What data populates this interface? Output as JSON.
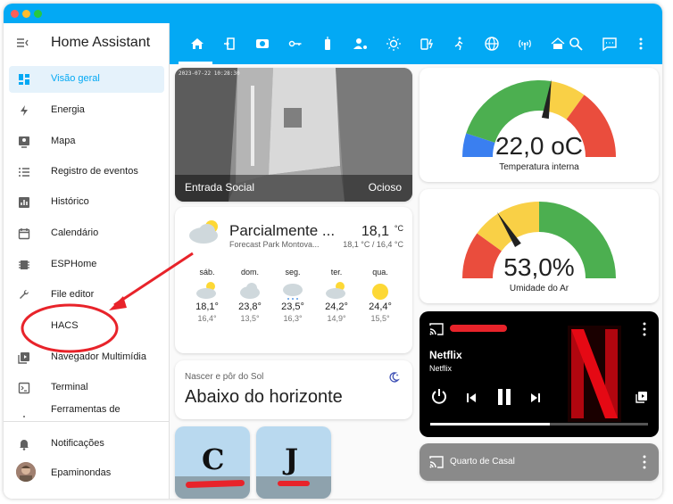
{
  "app": {
    "title": "Home Assistant"
  },
  "colors": {
    "primary": "#03a9f4",
    "active_bg": "#e5f2fb",
    "gauge_green": "#4caf50",
    "gauge_yellow": "#f9d046",
    "gauge_red": "#ea4d3d",
    "gauge_blue": "#3a7ff0",
    "annotation_red": "#e8232a"
  },
  "sidebar": {
    "menu_icon": "menu-open-icon",
    "items": [
      {
        "label": "Visão geral",
        "icon": "view-dashboard-icon",
        "active": true
      },
      {
        "label": "Energia",
        "icon": "lightning-bolt-icon"
      },
      {
        "label": "Mapa",
        "icon": "map-icon"
      },
      {
        "label": "Registro de eventos",
        "icon": "list-icon"
      },
      {
        "label": "Histórico",
        "icon": "chart-box-icon"
      },
      {
        "label": "Calendário",
        "icon": "calendar-icon"
      },
      {
        "label": "ESPHome",
        "icon": "chip-icon"
      },
      {
        "label": "File editor",
        "icon": "wrench-icon"
      },
      {
        "label": "HACS",
        "icon": ""
      },
      {
        "label": "Navegador Multimídia",
        "icon": "play-box-multiple-icon"
      },
      {
        "label": "Terminal",
        "icon": "console-icon"
      },
      {
        "label": "Ferramentas de",
        "icon": "hammer-icon"
      }
    ],
    "bottom": [
      {
        "label": "Notificações",
        "icon": "bell-icon"
      },
      {
        "label": "Epaminondas",
        "icon": "avatar"
      }
    ]
  },
  "toolbar": {
    "icons": [
      "home-icon",
      "door-icon",
      "cctv-icon",
      "key-icon",
      "remote-icon",
      "account-cog-icon",
      "lightbulb-icon",
      "power-plug-icon",
      "motion-sensor-icon",
      "web-icon",
      "wifi-router-icon",
      "home-search-icon",
      "search-icon",
      "chat-icon",
      "more-vert-icon"
    ]
  },
  "camera": {
    "name": "Entrada Social",
    "state": "Ocioso",
    "timestamp": "2023-07-22 10:28:30"
  },
  "weather": {
    "condition": "Parcialmente ...",
    "temp": "18,1",
    "unit": "°C",
    "location": "Forecast Park Montova...",
    "range": "18,1 °C / 16,4 °C",
    "forecast": [
      {
        "day": "sáb.",
        "icon": "partly-cloudy-icon",
        "high": "18,1°",
        "low": "16,4°"
      },
      {
        "day": "dom.",
        "icon": "cloudy-icon",
        "high": "23,8°",
        "low": "13,5°"
      },
      {
        "day": "seg.",
        "icon": "rainy-icon",
        "high": "23,5°",
        "low": "16,3°"
      },
      {
        "day": "ter.",
        "icon": "partly-cloudy-icon",
        "high": "24,2°",
        "low": "14,9°"
      },
      {
        "day": "qua.",
        "icon": "sunny-icon",
        "high": "24,4°",
        "low": "15,5°"
      }
    ]
  },
  "sun": {
    "title": "Nascer e pôr do Sol",
    "state": "Abaixo do horizonte",
    "icon": "weather-night-icon"
  },
  "gauge_temp": {
    "value": "22,0 oC",
    "label": "Temperatura interna",
    "fraction": 0.55
  },
  "gauge_humidity": {
    "value": "53,0%",
    "label": "Umidade do Ar",
    "fraction": 0.32
  },
  "media": {
    "app": "Netflix",
    "title": "Netflix",
    "progress": 0.55,
    "cast_icon": "cast-icon",
    "more_icon": "more-vert-icon"
  },
  "media2": {
    "name": "Quarto de Casal",
    "cast_icon": "cast-icon",
    "more_icon": "more-vert-icon"
  },
  "people": [
    {
      "initial": "C"
    },
    {
      "initial": "J"
    }
  ],
  "annotation": {
    "label_target": "HACS"
  }
}
